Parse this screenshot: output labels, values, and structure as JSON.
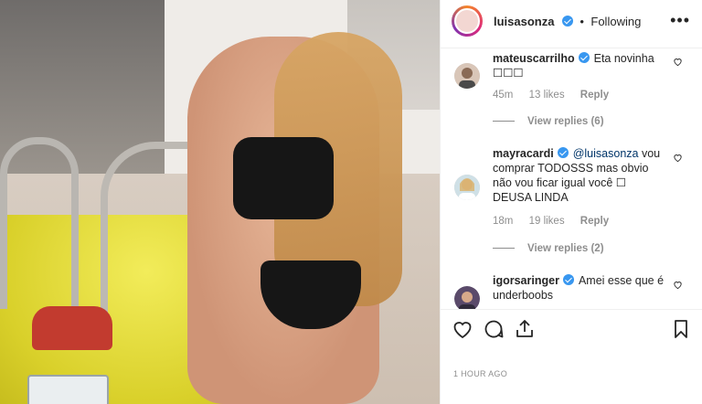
{
  "post": {
    "username": "luisasonza",
    "follow_status": "Following",
    "separator": "•",
    "more_label": "•••",
    "timestamp": "1 HOUR AGO"
  },
  "comments": [
    {
      "username": "mateuscarrilho",
      "text": "Eta novinha ☐☐☐",
      "time": "45m",
      "likes": "13 likes",
      "reply_label": "Reply",
      "view_replies": "View replies (6)",
      "avatar_color": "#d9c6b8"
    },
    {
      "username": "mayracardi",
      "mention": "@luisasonza",
      "text": " vou comprar TODOSSS mas obvio não vou ficar igual você ☐ DEUSA LINDA",
      "time": "18m",
      "likes": "19 likes",
      "reply_label": "Reply",
      "view_replies": "View replies (2)",
      "avatar_color": "#cfe0e6"
    },
    {
      "username": "igorsaringer",
      "text": "Amei esse que é underboobs",
      "avatar_color": "#5a4a6a"
    }
  ],
  "icons": [
    "heart-icon",
    "comment-icon",
    "share-icon",
    "bookmark-icon",
    "verified-badge-icon"
  ],
  "colors": {
    "verified": "#3897f0",
    "mention": "#003569",
    "muted": "#8e8e8e",
    "border": "#efefef"
  }
}
